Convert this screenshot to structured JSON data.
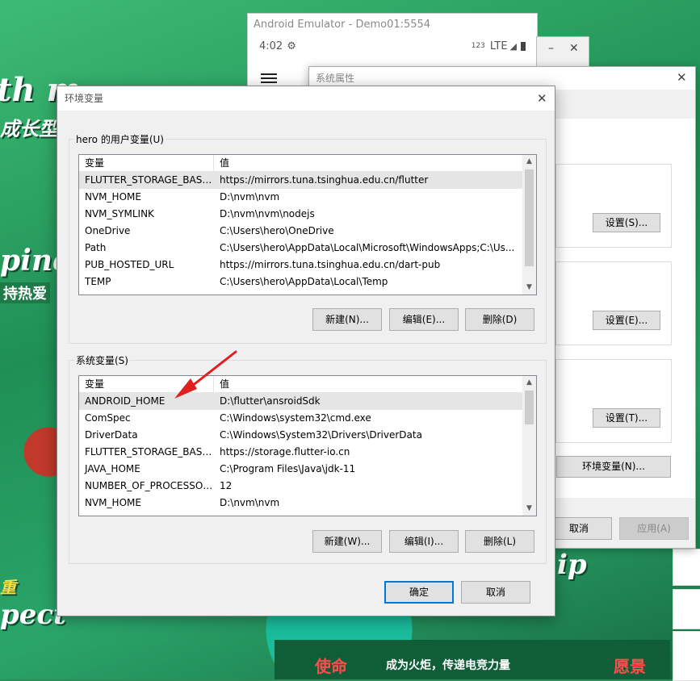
{
  "wallpaper": {
    "text_top": "th m",
    "text_line2": "成长型",
    "text_pine": "pine",
    "text_love": "持热爱",
    "text_pect": "pect",
    "text_ip": "ip",
    "text_zhong": "重",
    "bottom_left": "使命",
    "bottom_mid": "成为火炬，传递电竞力量",
    "bottom_right": "愿景"
  },
  "emulator": {
    "title": "Android Emulator - Demo01:5554",
    "time": "4:02",
    "signal": "LTE",
    "tag": "123"
  },
  "sysprop": {
    "title": "系统属性",
    "btn_settings1": "设置(S)...",
    "btn_settings2": "设置(E)...",
    "btn_settings3": "设置(T)...",
    "btn_env": "环境变量(N)...",
    "btn_cancel": "取消",
    "btn_apply": "应用(A)"
  },
  "env": {
    "title": "环境变量",
    "user_group": "hero 的用户变量(U)",
    "sys_group": "系统变量(S)",
    "col_var": "变量",
    "col_val": "值",
    "user_vars": [
      {
        "name": "FLUTTER_STORAGE_BASE_...",
        "value": "https://mirrors.tuna.tsinghua.edu.cn/flutter"
      },
      {
        "name": "NVM_HOME",
        "value": "D:\\nvm\\nvm"
      },
      {
        "name": "NVM_SYMLINK",
        "value": "D:\\nvm\\nvm\\nodejs"
      },
      {
        "name": "OneDrive",
        "value": "C:\\Users\\hero\\OneDrive"
      },
      {
        "name": "Path",
        "value": "C:\\Users\\hero\\AppData\\Local\\Microsoft\\WindowsApps;C:\\Us..."
      },
      {
        "name": "PUB_HOSTED_URL",
        "value": "https://mirrors.tuna.tsinghua.edu.cn/dart-pub"
      },
      {
        "name": "TEMP",
        "value": "C:\\Users\\hero\\AppData\\Local\\Temp"
      }
    ],
    "sys_vars": [
      {
        "name": "ANDROID_HOME",
        "value": "D:\\flutter\\ansroidSdk"
      },
      {
        "name": "ComSpec",
        "value": "C:\\Windows\\system32\\cmd.exe"
      },
      {
        "name": "DriverData",
        "value": "C:\\Windows\\System32\\Drivers\\DriverData"
      },
      {
        "name": "FLUTTER_STORAGE_BASE_...",
        "value": "https://storage.flutter-io.cn"
      },
      {
        "name": "JAVA_HOME",
        "value": "C:\\Program Files\\Java\\jdk-11"
      },
      {
        "name": "NUMBER_OF_PROCESSORS",
        "value": "12"
      },
      {
        "name": "NVM_HOME",
        "value": "D:\\nvm\\nvm"
      }
    ],
    "user_new": "新建(N)...",
    "user_edit": "编辑(E)...",
    "user_delete": "删除(D)",
    "sys_new": "新建(W)...",
    "sys_edit": "编辑(I)...",
    "sys_delete": "删除(L)",
    "ok": "确定",
    "cancel": "取消"
  },
  "colors": {
    "accent": "#0078d7",
    "selection": "#e5e5e5",
    "annotation_arrow": "#e02020"
  }
}
